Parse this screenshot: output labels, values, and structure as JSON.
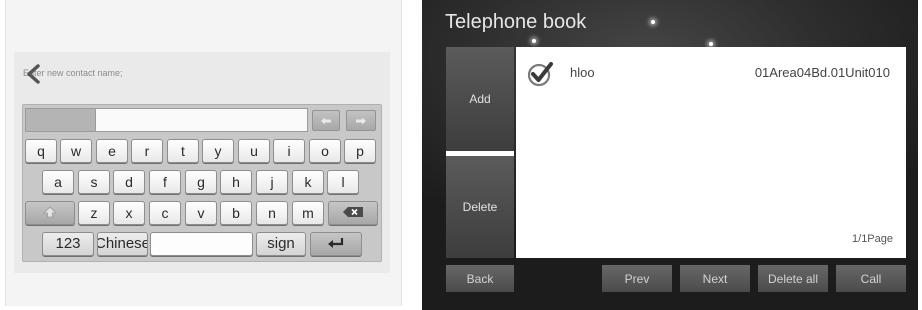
{
  "contact_entry": {
    "prompt": "Enter new contact name;",
    "name_input_value": "",
    "keyboard": {
      "letter_rows": [
        [
          "q",
          "w",
          "e",
          "r",
          "t",
          "y",
          "u",
          "i",
          "o",
          "p"
        ],
        [
          "a",
          "s",
          "d",
          "f",
          "g",
          "h",
          "j",
          "k",
          "l"
        ],
        [
          "z",
          "x",
          "c",
          "v",
          "b",
          "n",
          "m"
        ]
      ],
      "numbers_key": "123",
      "language_key": "Chinese",
      "sign_key": "sign"
    }
  },
  "phonebook": {
    "title": "Telephone book",
    "sidebar": {
      "add": "Add",
      "delete": "Delete"
    },
    "contacts": [
      {
        "name": "hloo",
        "address": "01Area04Bd.01Unit010",
        "selected": true
      }
    ],
    "page_indicator": "1/1Page",
    "footer": {
      "back": "Back",
      "prev": "Prev",
      "next": "Next",
      "delete_all": "Delete all",
      "call": "Call"
    }
  },
  "icons": {
    "back": "back-arrow-icon",
    "cursor_left": "arrow-left-icon",
    "cursor_right": "arrow-right-icon",
    "shift": "shift-icon",
    "backspace": "backspace-icon",
    "enter": "enter-icon",
    "contact_selected": "check-circle-icon"
  },
  "colors": {
    "phonebook_background": "#262626",
    "phonebook_button": "#555555",
    "list_background": "#ffffff",
    "keyboard_background": "#c8c8c8"
  }
}
